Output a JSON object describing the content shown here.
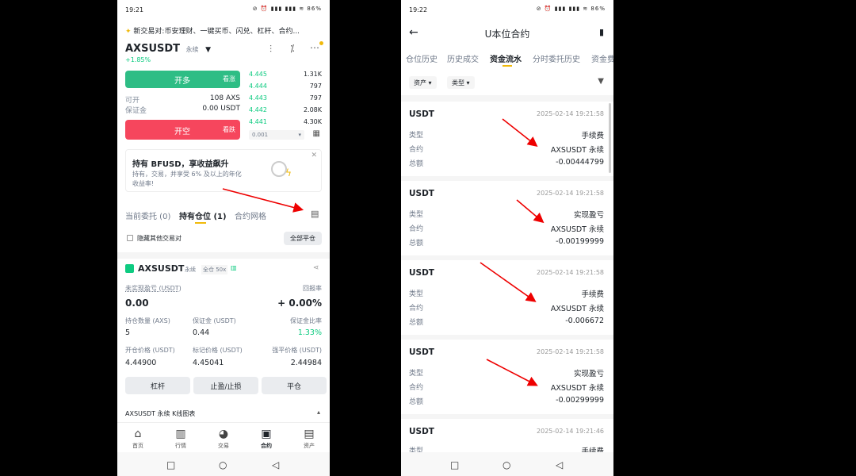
{
  "left": {
    "status": {
      "time": "19:21",
      "icons": "⊘ ⏰ ▮▮▮ ▮▮▮ ≋ 86%"
    },
    "announcement": "新交易对:币安理财、一键买币、闪兑、杠杆、合约...",
    "symbol": "AXSUSDT",
    "symbol_type": "永续",
    "change": "+1.85%",
    "open_long": "开多",
    "bullish": "看涨",
    "available_label": "可开",
    "available_value": "108 AXS",
    "margin_label": "保证金",
    "margin_value": "0.00 USDT",
    "open_short": "开空",
    "bearish": "看跌",
    "orderbook": [
      {
        "price": "4.445",
        "qty": "1.31K"
      },
      {
        "price": "4.444",
        "qty": "797"
      },
      {
        "price": "4.443",
        "qty": "797"
      },
      {
        "price": "4.442",
        "qty": "2.08K"
      },
      {
        "price": "4.441",
        "qty": "4.30K"
      }
    ],
    "depth_select": "0.001",
    "promo_title": "持有 BFUSD，享收益飙升",
    "promo_line1": "持有，交易，并享受 6% 及以上的年化",
    "promo_line2": "收益率!",
    "tabs": {
      "open_orders": "当前委托 (0)",
      "positions": "持有仓位 (1)",
      "grid": "合约网格"
    },
    "hide_others": "隐藏其他交易对",
    "close_all": "全部平仓",
    "position": {
      "symbol": "AXSUSDT",
      "type": "永续",
      "mode": "全仓 50x",
      "pnl_label": "未实现盈亏 (USDT)",
      "roe_label": "回报率",
      "pnl_value": "0.00",
      "roe_value": "+ 0.00%",
      "size_label": "持仓数量 (AXS)",
      "margin_label": "保证金 (USDT)",
      "margin_ratio_label": "保证金比率",
      "size_value": "5",
      "margin_value": "0.44",
      "margin_ratio_value": "1.33%",
      "entry_label": "开仓价格 (USDT)",
      "mark_label": "标记价格 (USDT)",
      "liq_label": "强平价格 (USDT)",
      "entry_value": "4.44900",
      "mark_value": "4.45041",
      "liq_value": "2.44984",
      "btn_leverage": "杠杆",
      "btn_tpsl": "止盈/止损",
      "btn_close": "平仓"
    },
    "kline_label": "AXSUSDT 永续 K线图表",
    "bottom_tabs": [
      "首页",
      "行情",
      "交易",
      "合约",
      "资产"
    ]
  },
  "right": {
    "status": {
      "time": "19:22",
      "icons": "⊘ ⏰ ▮▮▮ ▮▮▮ ≋ 86%"
    },
    "title": "U本位合约",
    "tabs": [
      "仓位历史",
      "历史成交",
      "资金流水",
      "分时委托历史",
      "资金费"
    ],
    "filters": {
      "asset": "资产",
      "type": "类型"
    },
    "labels": {
      "type": "类型",
      "contract": "合约",
      "amount": "总额"
    },
    "records": [
      {
        "coin": "USDT",
        "time": "2025-02-14 19:21:58",
        "type": "手续费",
        "contract": "AXSUSDT 永续",
        "amount": "-0.00444799"
      },
      {
        "coin": "USDT",
        "time": "2025-02-14 19:21:58",
        "type": "实现盈亏",
        "contract": "AXSUSDT 永续",
        "amount": "-0.00199999"
      },
      {
        "coin": "USDT",
        "time": "2025-02-14 19:21:58",
        "type": "手续费",
        "contract": "AXSUSDT 永续",
        "amount": "-0.006672"
      },
      {
        "coin": "USDT",
        "time": "2025-02-14 19:21:58",
        "type": "实现盈亏",
        "contract": "AXSUSDT 永续",
        "amount": "-0.00299999"
      },
      {
        "coin": "USDT",
        "time": "2025-02-14 19:21:46",
        "type": "手续费",
        "contract": "",
        "amount": ""
      }
    ]
  }
}
